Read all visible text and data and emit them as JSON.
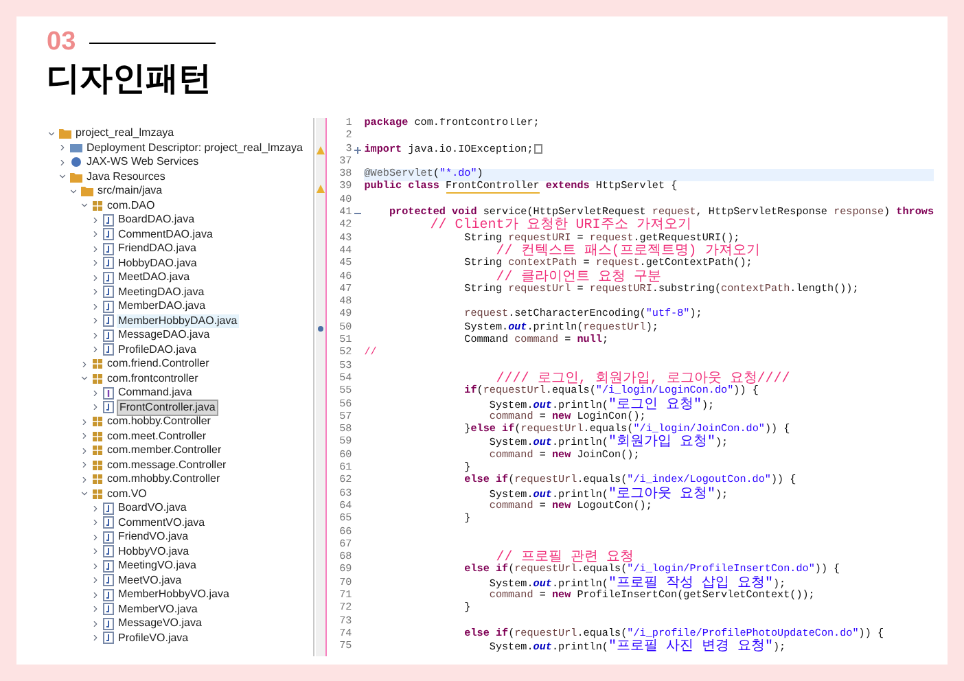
{
  "slide": {
    "number": "03",
    "title": "디자인패턴"
  },
  "tree": [
    {
      "kind": "project",
      "label": "project_real_lmzaya",
      "expanded": true,
      "selected": false,
      "hovered": false,
      "children": [
        {
          "kind": "descriptor",
          "label": "Deployment Descriptor: project_real_lmzaya",
          "expanded": false,
          "selected": false,
          "hovered": false
        },
        {
          "kind": "webservices",
          "label": "JAX-WS Web Services",
          "expanded": false,
          "selected": false,
          "hovered": false
        },
        {
          "kind": "resources",
          "label": "Java Resources",
          "expanded": true,
          "selected": false,
          "hovered": false,
          "children": [
            {
              "kind": "source-folder",
              "label": "src/main/java",
              "expanded": true,
              "selected": false,
              "hovered": false,
              "children": [
                {
                  "kind": "package",
                  "label": "com.DAO",
                  "expanded": true,
                  "selected": false,
                  "hovered": false,
                  "children": [
                    {
                      "kind": "class",
                      "label": "BoardDAO.java",
                      "expanded": false,
                      "selected": false,
                      "hovered": false
                    },
                    {
                      "kind": "class",
                      "label": "CommentDAO.java",
                      "expanded": false,
                      "selected": false,
                      "hovered": false
                    },
                    {
                      "kind": "class",
                      "label": "FriendDAO.java",
                      "expanded": false,
                      "selected": false,
                      "hovered": false
                    },
                    {
                      "kind": "class",
                      "label": "HobbyDAO.java",
                      "expanded": false,
                      "selected": false,
                      "hovered": false
                    },
                    {
                      "kind": "class",
                      "label": "MeetDAO.java",
                      "expanded": false,
                      "selected": false,
                      "hovered": false
                    },
                    {
                      "kind": "class",
                      "label": "MeetingDAO.java",
                      "expanded": false,
                      "selected": false,
                      "hovered": false
                    },
                    {
                      "kind": "class",
                      "label": "MemberDAO.java",
                      "expanded": false,
                      "selected": false,
                      "hovered": false
                    },
                    {
                      "kind": "class",
                      "label": "MemberHobbyDAO.java",
                      "expanded": false,
                      "selected": false,
                      "hovered": true
                    },
                    {
                      "kind": "class",
                      "label": "MessageDAO.java",
                      "expanded": false,
                      "selected": false,
                      "hovered": false
                    },
                    {
                      "kind": "class",
                      "label": "ProfileDAO.java",
                      "expanded": false,
                      "selected": false,
                      "hovered": false
                    }
                  ]
                },
                {
                  "kind": "package",
                  "label": "com.friend.Controller",
                  "expanded": false,
                  "selected": false,
                  "hovered": false
                },
                {
                  "kind": "package",
                  "label": "com.frontcontroller",
                  "expanded": true,
                  "selected": false,
                  "hovered": false,
                  "children": [
                    {
                      "kind": "interface",
                      "label": "Command.java",
                      "expanded": false,
                      "selected": false,
                      "hovered": false
                    },
                    {
                      "kind": "class",
                      "label": "FrontController.java",
                      "expanded": false,
                      "selected": true,
                      "hovered": false
                    }
                  ]
                },
                {
                  "kind": "package",
                  "label": "com.hobby.Controller",
                  "expanded": false,
                  "selected": false,
                  "hovered": false
                },
                {
                  "kind": "package",
                  "label": "com.meet.Controller",
                  "expanded": false,
                  "selected": false,
                  "hovered": false
                },
                {
                  "kind": "package",
                  "label": "com.member.Controller",
                  "expanded": false,
                  "selected": false,
                  "hovered": false
                },
                {
                  "kind": "package",
                  "label": "com.message.Controller",
                  "expanded": false,
                  "selected": false,
                  "hovered": false
                },
                {
                  "kind": "package",
                  "label": "com.mhobby.Controller",
                  "expanded": false,
                  "selected": false,
                  "hovered": false
                },
                {
                  "kind": "package",
                  "label": "com.VO",
                  "expanded": true,
                  "selected": false,
                  "hovered": false,
                  "children": [
                    {
                      "kind": "class",
                      "label": "BoardVO.java",
                      "expanded": false,
                      "selected": false,
                      "hovered": false
                    },
                    {
                      "kind": "class",
                      "label": "CommentVO.java",
                      "expanded": false,
                      "selected": false,
                      "hovered": false
                    },
                    {
                      "kind": "class",
                      "label": "FriendVO.java",
                      "expanded": false,
                      "selected": false,
                      "hovered": false
                    },
                    {
                      "kind": "class",
                      "label": "HobbyVO.java",
                      "expanded": false,
                      "selected": false,
                      "hovered": false
                    },
                    {
                      "kind": "class",
                      "label": "MeetingVO.java",
                      "expanded": false,
                      "selected": false,
                      "hovered": false
                    },
                    {
                      "kind": "class",
                      "label": "MeetVO.java",
                      "expanded": false,
                      "selected": false,
                      "hovered": false
                    },
                    {
                      "kind": "class",
                      "label": "MemberHobbyVO.java",
                      "expanded": false,
                      "selected": false,
                      "hovered": false
                    },
                    {
                      "kind": "class",
                      "label": "MemberVO.java",
                      "expanded": false,
                      "selected": false,
                      "hovered": false
                    },
                    {
                      "kind": "class",
                      "label": "MessageVO.java",
                      "expanded": false,
                      "selected": false,
                      "hovered": false
                    },
                    {
                      "kind": "class",
                      "label": "ProfileVO.java",
                      "expanded": false,
                      "selected": false,
                      "hovered": false
                    }
                  ]
                }
              ]
            }
          ]
        }
      ]
    }
  ],
  "editor": {
    "lines": [
      {
        "number": "1",
        "current": false,
        "tokens": [
          {
            "kind": "keyword",
            "text": "package"
          },
          {
            "kind": "plain",
            "text": " com.frontcontroller;"
          }
        ]
      },
      {
        "number": "2",
        "current": false
      },
      {
        "number": "3",
        "current": false,
        "warning": true,
        "collapsed": true,
        "tokens": [
          {
            "kind": "keyword",
            "text": "import"
          },
          {
            "kind": "plain",
            "text": " java.io.IOException;"
          }
        ]
      },
      {
        "number": "37",
        "current": false
      },
      {
        "number": "38",
        "current": true,
        "tokens": [
          {
            "kind": "annotation",
            "text": "@WebServlet"
          },
          {
            "kind": "plain",
            "text": "("
          },
          {
            "kind": "string",
            "text": "\"*.do\""
          },
          {
            "kind": "plain",
            "text": ")"
          }
        ]
      },
      {
        "number": "39",
        "current": false,
        "warning": true,
        "tokens": [
          {
            "kind": "keyword",
            "text": "public class "
          },
          {
            "kind": "warned",
            "text": "FrontController"
          },
          {
            "kind": "keyword",
            "text": " extends"
          },
          {
            "kind": "plain",
            "text": " HttpServlet {"
          }
        ]
      },
      {
        "number": "40",
        "current": false
      },
      {
        "number": "41",
        "current": false,
        "collapsed": false,
        "tokens": [
          {
            "kind": "keyword",
            "text": "    protected void"
          },
          {
            "kind": "plain",
            "text": " service(HttpServletRequest "
          },
          {
            "kind": "local",
            "text": "request"
          },
          {
            "kind": "plain",
            "text": ", HttpServletResponse "
          },
          {
            "kind": "local",
            "text": "response"
          },
          {
            "kind": "plain",
            "text": ") "
          },
          {
            "kind": "keyword",
            "text": "throws"
          }
        ]
      },
      {
        "number": "42",
        "current": false,
        "tokens": [
          {
            "kind": "comment",
            "text": "        // Client가 요청한 URI주소 가져오기"
          }
        ]
      },
      {
        "number": "43",
        "current": false,
        "tokens": [
          {
            "kind": "plain",
            "text": "                String "
          },
          {
            "kind": "local",
            "text": "requestURI"
          },
          {
            "kind": "plain",
            "text": " = "
          },
          {
            "kind": "local",
            "text": "request"
          },
          {
            "kind": "plain",
            "text": ".getRequestURI();"
          }
        ]
      },
      {
        "number": "44",
        "current": false,
        "tokens": [
          {
            "kind": "comment",
            "text": "                // 컨텍스트 패스(프로젝트명) 가져오기"
          }
        ]
      },
      {
        "number": "45",
        "current": false,
        "tokens": [
          {
            "kind": "plain",
            "text": "                String "
          },
          {
            "kind": "local",
            "text": "contextPath"
          },
          {
            "kind": "plain",
            "text": " = "
          },
          {
            "kind": "local",
            "text": "request"
          },
          {
            "kind": "plain",
            "text": ".getContextPath();"
          }
        ]
      },
      {
        "number": "46",
        "current": false,
        "tokens": [
          {
            "kind": "comment",
            "text": "                // 클라이언트 요청 구분"
          }
        ]
      },
      {
        "number": "47",
        "current": false,
        "tokens": [
          {
            "kind": "plain",
            "text": "                String "
          },
          {
            "kind": "local",
            "text": "requestUrl"
          },
          {
            "kind": "plain",
            "text": " = "
          },
          {
            "kind": "local",
            "text": "requestURI"
          },
          {
            "kind": "plain",
            "text": ".substring("
          },
          {
            "kind": "local",
            "text": "contextPath"
          },
          {
            "kind": "plain",
            "text": ".length());"
          }
        ]
      },
      {
        "number": "48",
        "current": false
      },
      {
        "number": "49",
        "current": false,
        "tokens": [
          {
            "kind": "local",
            "text": "                request"
          },
          {
            "kind": "plain",
            "text": ".setCharacterEncoding("
          },
          {
            "kind": "string",
            "text": "\"utf-8\""
          },
          {
            "kind": "plain",
            "text": ");"
          }
        ]
      },
      {
        "number": "50",
        "current": false,
        "breakpoint": true,
        "tokens": [
          {
            "kind": "plain",
            "text": "                System."
          },
          {
            "kind": "field",
            "text": "out"
          },
          {
            "kind": "plain",
            "text": ".println("
          },
          {
            "kind": "local",
            "text": "requestUrl"
          },
          {
            "kind": "plain",
            "text": ");"
          }
        ]
      },
      {
        "number": "51",
        "current": false,
        "tokens": [
          {
            "kind": "plain",
            "text": "                Command "
          },
          {
            "kind": "local",
            "text": "command"
          },
          {
            "kind": "plain",
            "text": " = "
          },
          {
            "kind": "keyword",
            "text": "null"
          },
          {
            "kind": "plain",
            "text": ";"
          }
        ]
      },
      {
        "number": "52",
        "current": false,
        "tokens": [
          {
            "kind": "comment",
            "text": "//"
          }
        ]
      },
      {
        "number": "53",
        "current": false
      },
      {
        "number": "54",
        "current": false,
        "tokens": [
          {
            "kind": "comment",
            "text": "                //// 로그인, 회원가입, 로그아웃 요청////"
          }
        ]
      },
      {
        "number": "55",
        "current": false,
        "tokens": [
          {
            "kind": "keyword",
            "text": "                if"
          },
          {
            "kind": "plain",
            "text": "("
          },
          {
            "kind": "local",
            "text": "requestUrl"
          },
          {
            "kind": "plain",
            "text": ".equals("
          },
          {
            "kind": "string",
            "text": "\"/i_login/LoginCon.do\""
          },
          {
            "kind": "plain",
            "text": ")) {"
          }
        ]
      },
      {
        "number": "56",
        "current": false,
        "tokens": [
          {
            "kind": "plain",
            "text": "                    System."
          },
          {
            "kind": "field",
            "text": "out"
          },
          {
            "kind": "plain",
            "text": ".println("
          },
          {
            "kind": "string",
            "text": "\"로그인 요청\""
          },
          {
            "kind": "plain",
            "text": ");"
          }
        ]
      },
      {
        "number": "57",
        "current": false,
        "tokens": [
          {
            "kind": "local",
            "text": "                    command"
          },
          {
            "kind": "plain",
            "text": " = "
          },
          {
            "kind": "keyword",
            "text": "new"
          },
          {
            "kind": "plain",
            "text": " LoginCon();"
          }
        ]
      },
      {
        "number": "58",
        "current": false,
        "tokens": [
          {
            "kind": "plain",
            "text": "                }"
          },
          {
            "kind": "keyword",
            "text": "else if"
          },
          {
            "kind": "plain",
            "text": "("
          },
          {
            "kind": "local",
            "text": "requestUrl"
          },
          {
            "kind": "plain",
            "text": ".equals("
          },
          {
            "kind": "string",
            "text": "\"/i_login/JoinCon.do\""
          },
          {
            "kind": "plain",
            "text": ")) {"
          }
        ]
      },
      {
        "number": "59",
        "current": false,
        "tokens": [
          {
            "kind": "plain",
            "text": "                    System."
          },
          {
            "kind": "field",
            "text": "out"
          },
          {
            "kind": "plain",
            "text": ".println("
          },
          {
            "kind": "string",
            "text": "\"회원가입 요청\""
          },
          {
            "kind": "plain",
            "text": ");"
          }
        ]
      },
      {
        "number": "60",
        "current": false,
        "tokens": [
          {
            "kind": "local",
            "text": "                    command"
          },
          {
            "kind": "plain",
            "text": " = "
          },
          {
            "kind": "keyword",
            "text": "new"
          },
          {
            "kind": "plain",
            "text": " JoinCon();"
          }
        ]
      },
      {
        "number": "61",
        "current": false,
        "tokens": [
          {
            "kind": "plain",
            "text": "                }"
          }
        ]
      },
      {
        "number": "62",
        "current": false,
        "tokens": [
          {
            "kind": "keyword",
            "text": "                else if"
          },
          {
            "kind": "plain",
            "text": "("
          },
          {
            "kind": "local",
            "text": "requestUrl"
          },
          {
            "kind": "plain",
            "text": ".equals("
          },
          {
            "kind": "string",
            "text": "\"/i_index/LogoutCon.do\""
          },
          {
            "kind": "plain",
            "text": ")) {"
          }
        ]
      },
      {
        "number": "63",
        "current": false,
        "tokens": [
          {
            "kind": "plain",
            "text": "                    System."
          },
          {
            "kind": "field",
            "text": "out"
          },
          {
            "kind": "plain",
            "text": ".println("
          },
          {
            "kind": "string",
            "text": "\"로그아웃 요청\""
          },
          {
            "kind": "plain",
            "text": ");"
          }
        ]
      },
      {
        "number": "64",
        "current": false,
        "tokens": [
          {
            "kind": "local",
            "text": "                    command"
          },
          {
            "kind": "plain",
            "text": " = "
          },
          {
            "kind": "keyword",
            "text": "new"
          },
          {
            "kind": "plain",
            "text": " LogoutCon();"
          }
        ]
      },
      {
        "number": "65",
        "current": false,
        "tokens": [
          {
            "kind": "plain",
            "text": "                }"
          }
        ]
      },
      {
        "number": "66",
        "current": false
      },
      {
        "number": "67",
        "current": false
      },
      {
        "number": "68",
        "current": false,
        "tokens": [
          {
            "kind": "comment",
            "text": "                // 프로필 관련 요청"
          }
        ]
      },
      {
        "number": "69",
        "current": false,
        "tokens": [
          {
            "kind": "keyword",
            "text": "                else if"
          },
          {
            "kind": "plain",
            "text": "("
          },
          {
            "kind": "local",
            "text": "requestUrl"
          },
          {
            "kind": "plain",
            "text": ".equals("
          },
          {
            "kind": "string",
            "text": "\"/i_login/ProfileInsertCon.do\""
          },
          {
            "kind": "plain",
            "text": ")) {"
          }
        ]
      },
      {
        "number": "70",
        "current": false,
        "tokens": [
          {
            "kind": "plain",
            "text": "                    System."
          },
          {
            "kind": "field",
            "text": "out"
          },
          {
            "kind": "plain",
            "text": ".println("
          },
          {
            "kind": "string",
            "text": "\"프로필 작성 삽입 요청\""
          },
          {
            "kind": "plain",
            "text": ");"
          }
        ]
      },
      {
        "number": "71",
        "current": false,
        "tokens": [
          {
            "kind": "local",
            "text": "                    command"
          },
          {
            "kind": "plain",
            "text": " = "
          },
          {
            "kind": "keyword",
            "text": "new"
          },
          {
            "kind": "plain",
            "text": " ProfileInsertCon(getServletContext());"
          }
        ]
      },
      {
        "number": "72",
        "current": false,
        "tokens": [
          {
            "kind": "plain",
            "text": "                }"
          }
        ]
      },
      {
        "number": "73",
        "current": false
      },
      {
        "number": "74",
        "current": false,
        "tokens": [
          {
            "kind": "keyword",
            "text": "                else if"
          },
          {
            "kind": "plain",
            "text": "("
          },
          {
            "kind": "local",
            "text": "requestUrl"
          },
          {
            "kind": "plain",
            "text": ".equals("
          },
          {
            "kind": "string",
            "text": "\"/i_profile/ProfilePhotoUpdateCon.do\""
          },
          {
            "kind": "plain",
            "text": ")) {"
          }
        ]
      },
      {
        "number": "75",
        "current": false,
        "tokens": [
          {
            "kind": "plain",
            "text": "                    System."
          },
          {
            "kind": "field",
            "text": "out"
          },
          {
            "kind": "plain",
            "text": ".println("
          },
          {
            "kind": "string",
            "text": "\"프로필 사진 변경 요청\""
          },
          {
            "kind": "plain",
            "text": ");"
          }
        ]
      }
    ]
  }
}
